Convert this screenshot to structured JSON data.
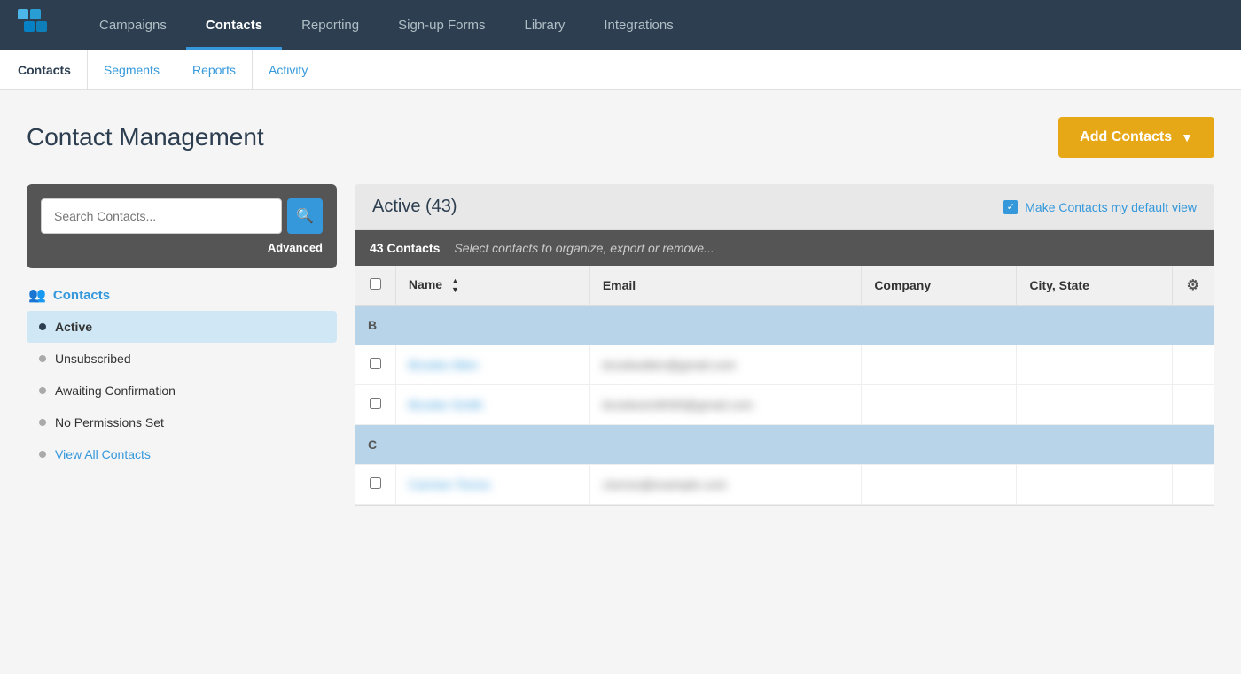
{
  "topNav": {
    "items": [
      {
        "id": "campaigns",
        "label": "Campaigns",
        "active": false
      },
      {
        "id": "contacts",
        "label": "Contacts",
        "active": true
      },
      {
        "id": "reporting",
        "label": "Reporting",
        "active": false
      },
      {
        "id": "signup-forms",
        "label": "Sign-up Forms",
        "active": false
      },
      {
        "id": "library",
        "label": "Library",
        "active": false
      },
      {
        "id": "integrations",
        "label": "Integrations",
        "active": false
      }
    ]
  },
  "subNav": {
    "items": [
      {
        "id": "contacts",
        "label": "Contacts",
        "active": true
      },
      {
        "id": "segments",
        "label": "Segments",
        "active": false
      },
      {
        "id": "reports",
        "label": "Reports",
        "active": false
      },
      {
        "id": "activity",
        "label": "Activity",
        "active": false
      }
    ]
  },
  "pageHeader": {
    "title": "Contact Management",
    "addButton": "Add Contacts"
  },
  "searchBox": {
    "placeholder": "Search Contacts...",
    "advancedLabel": "Advanced"
  },
  "sidebar": {
    "groupLabel": "Contacts",
    "items": [
      {
        "id": "active",
        "label": "Active",
        "active": true
      },
      {
        "id": "unsubscribed",
        "label": "Unsubscribed",
        "active": false
      },
      {
        "id": "awaiting",
        "label": "Awaiting Confirmation",
        "active": false
      },
      {
        "id": "no-permissions",
        "label": "No Permissions Set",
        "active": false
      }
    ],
    "viewAllLabel": "View All Contacts"
  },
  "activeBanner": {
    "title": "Active (43)",
    "defaultViewLabel": "Make Contacts my default view"
  },
  "tableHeader": {
    "count": "43 Contacts",
    "hint": "Select contacts to organize, export or remove...",
    "columns": [
      "Name",
      "Email",
      "Company",
      "City, State"
    ]
  },
  "tableData": {
    "groups": [
      {
        "letter": "B",
        "rows": [
          {
            "name": "Brooke Allen",
            "email": "brookeallen@gmail.com",
            "company": "",
            "city": ""
          },
          {
            "name": "Brooke Smith",
            "email": "brookesmith90@gmail.com",
            "company": "",
            "city": ""
          }
        ]
      },
      {
        "letter": "C",
        "rows": [
          {
            "name": "Carmen Torres",
            "email": "ctorres@example.com",
            "company": "",
            "city": ""
          }
        ]
      }
    ]
  }
}
